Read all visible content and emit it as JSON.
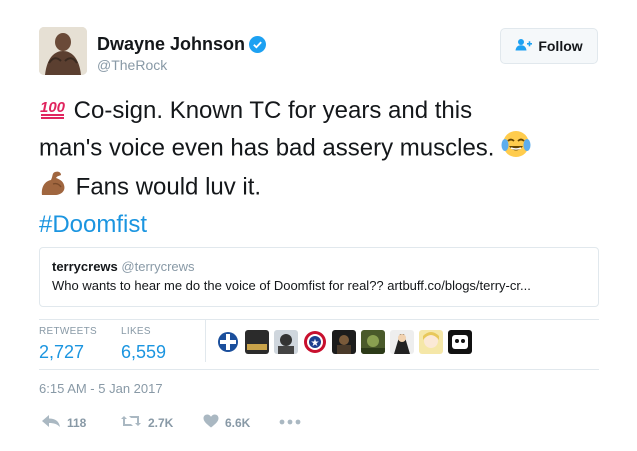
{
  "user": {
    "name": "Dwayne Johnson",
    "handle": "@TheRock",
    "verified": true
  },
  "follow_button": {
    "label": "Follow",
    "icon": "add-user-icon"
  },
  "tweet": {
    "line1_emoji": "hundred-points-emoji",
    "line1_text": " Co-sign. Known TC for years and this",
    "line2_text": "man's voice even has bad assery muscles. ",
    "line2_emoji": "tears-of-joy-emoji",
    "line3_emoji": "flexed-biceps-emoji",
    "line3_text": " Fans would luv it.",
    "hashtag": "#Doomfist"
  },
  "quoted_tweet": {
    "name": "terrycrews",
    "handle": "@terrycrews",
    "text": "Who wants to hear me do the voice of Doomfist for real?? artbuff.co/blogs/terry-cr..."
  },
  "stats": {
    "retweets_label": "RETWEETS",
    "retweets_value": "2,727",
    "likes_label": "LIKES",
    "likes_value": "6,559"
  },
  "likers": [
    "liker-avatar-1",
    "liker-avatar-2",
    "liker-avatar-3",
    "liker-avatar-4",
    "liker-avatar-5",
    "liker-avatar-6",
    "liker-avatar-7",
    "liker-avatar-8",
    "liker-avatar-9"
  ],
  "timestamp": "6:15 AM - 5 Jan 2017",
  "actions": {
    "reply_count": "118",
    "retweet_count": "2.7K",
    "like_count": "6.6K"
  },
  "colors": {
    "link": "#1b95e0",
    "muted": "#8899a6",
    "verified": "#1da1f2",
    "border": "#e1e8ed"
  }
}
